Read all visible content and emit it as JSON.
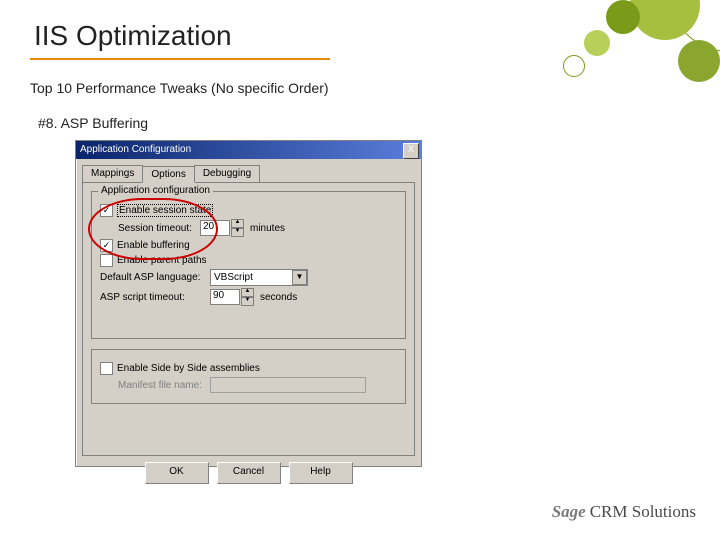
{
  "slide": {
    "title": "IIS Optimization",
    "subtitle": "Top 10 Performance Tweaks (No specific Order)",
    "item": "#8.  ASP Buffering"
  },
  "dialog": {
    "title": "Application Configuration",
    "close": "X",
    "tabs": {
      "mappings": "Mappings",
      "options": "Options",
      "debugging": "Debugging"
    },
    "group_appconfig": {
      "legend": "Application configuration",
      "enable_session": {
        "label": "Enable session state",
        "checked": true
      },
      "session_timeout_label": "Session timeout:",
      "session_timeout_value": "20",
      "minutes": "minutes",
      "enable_buffering": {
        "label": "Enable buffering",
        "checked": true
      },
      "enable_parent": {
        "label": "Enable parent paths",
        "checked": false
      },
      "default_lang_label": "Default ASP language:",
      "default_lang_value": "VBScript",
      "script_timeout_label": "ASP script timeout:",
      "script_timeout_value": "90",
      "seconds": "seconds"
    },
    "group_sxs": {
      "enable": {
        "label": "Enable Side by Side assemblies",
        "checked": false
      },
      "manifest_label": "Manifest file name:",
      "manifest_value": ""
    },
    "buttons": {
      "ok": "OK",
      "cancel": "Cancel",
      "help": "Help"
    }
  },
  "footer": {
    "brand_a": "Sage",
    "brand_b": "CRM Solutions"
  }
}
